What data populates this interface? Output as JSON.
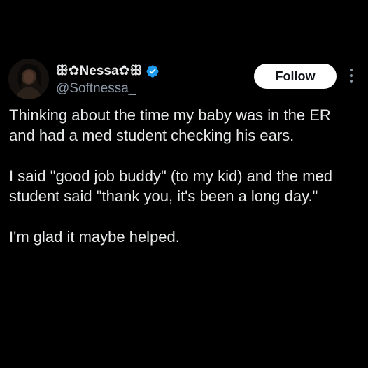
{
  "author": {
    "display_name": "ꕥ✿Nessa✿ꕥ",
    "handle": "@Softnessa_",
    "verified": true,
    "avatar_icon": "profile-photo"
  },
  "actions": {
    "follow_label": "Follow",
    "more_icon": "more-vertical-icon"
  },
  "tweet": {
    "paragraphs": [
      "Thinking about the time my baby was in the ER and had a med student checking his ears.",
      "I said \"good job buddy\" (to my kid) and the med student said \"thank you, it's been a long day.\"",
      "I'm glad it maybe helped."
    ]
  },
  "colors": {
    "background": "#000000",
    "text": "#e7e9ea",
    "secondary_text": "#8b98a5",
    "verified_badge": "#1d9bf0",
    "follow_button_bg": "#ffffff",
    "follow_button_text": "#0f1419"
  }
}
